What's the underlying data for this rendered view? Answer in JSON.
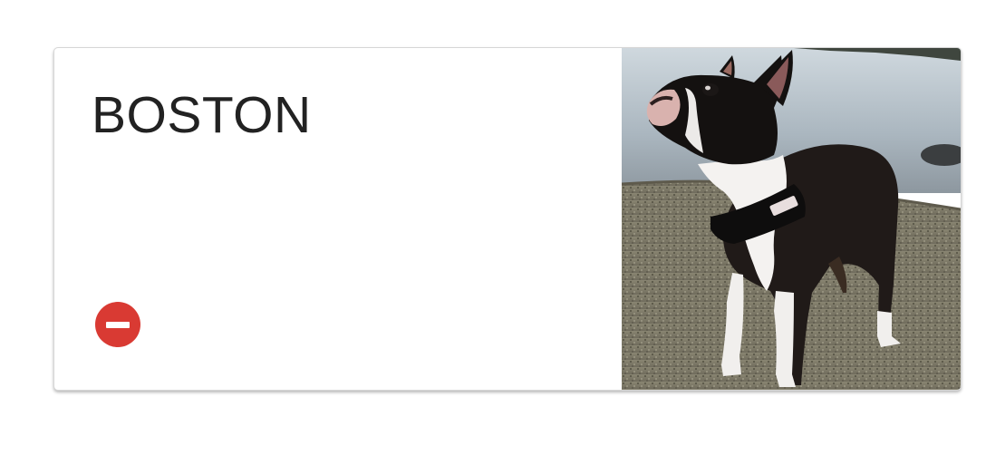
{
  "card": {
    "title": "BOSTON",
    "remove_button": {
      "icon": "minus-circle-icon",
      "color": "#d93a33"
    },
    "photo": {
      "subject": "dog-photo"
    }
  }
}
